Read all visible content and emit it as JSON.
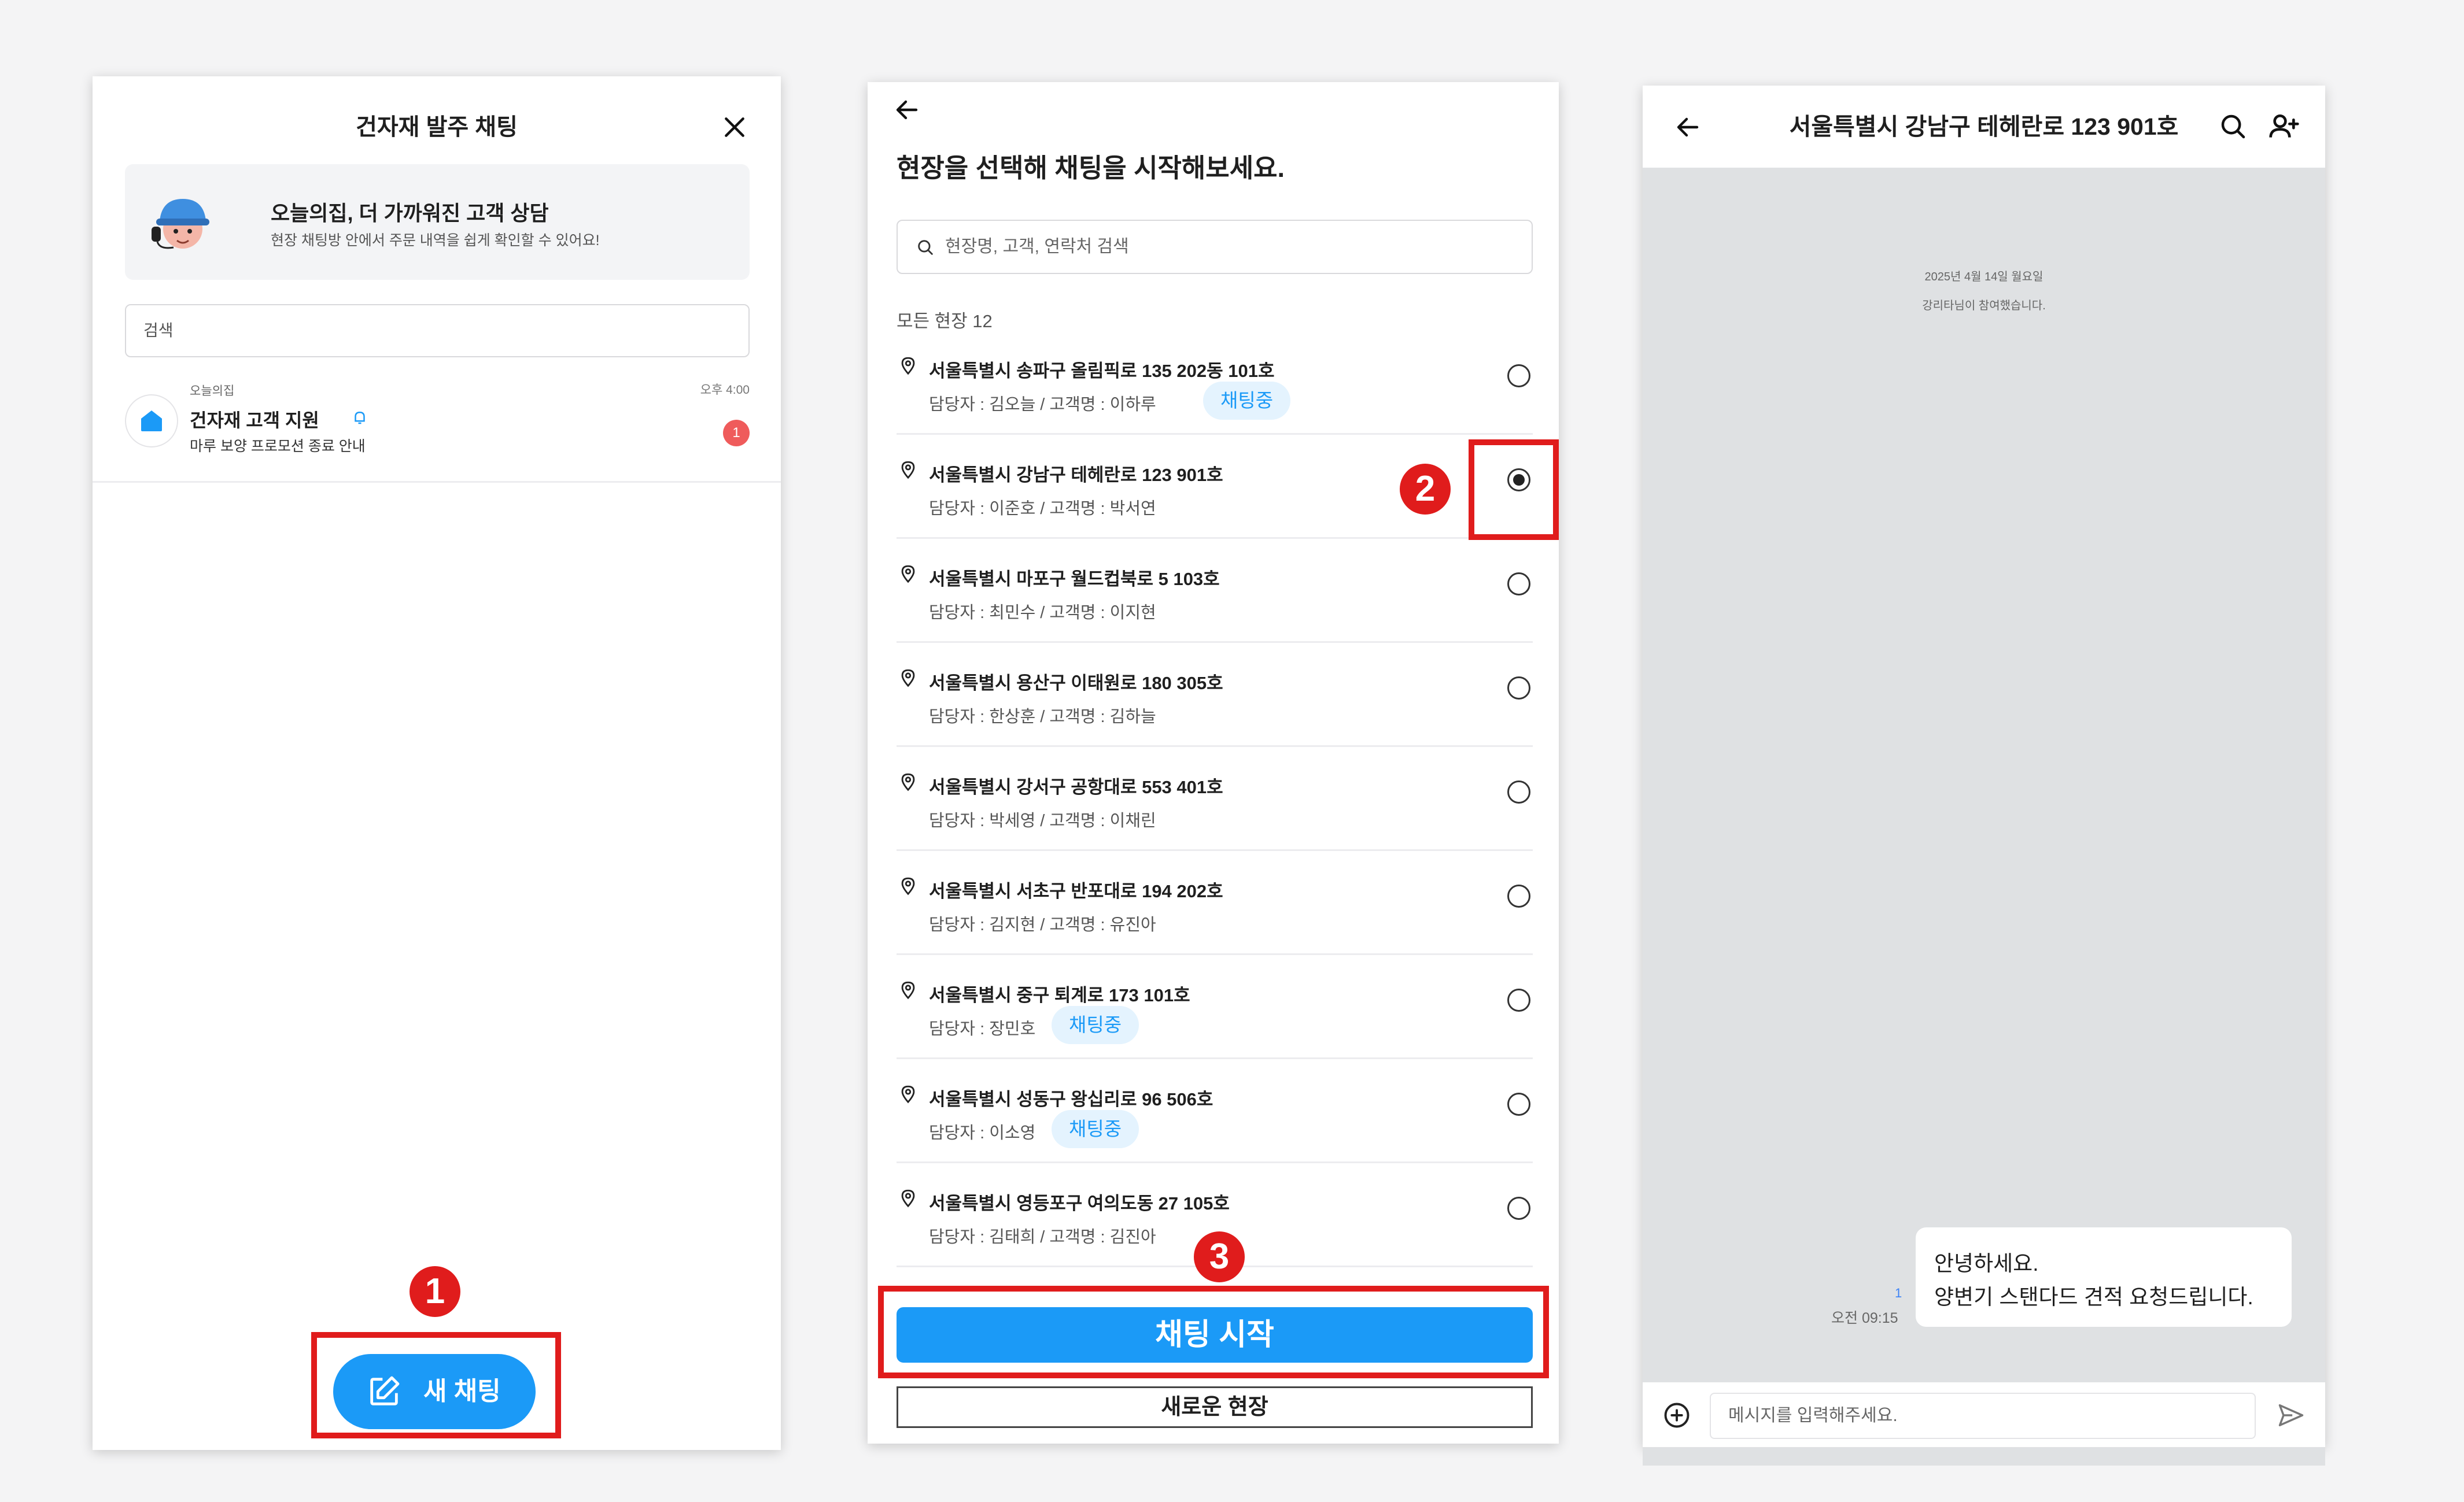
{
  "panel1": {
    "title": "건자재 발주 채팅",
    "banner": {
      "title": "오늘의집, 더 가까워진 고객 상담",
      "subtitle": "현장 채팅방 안에서 주문 내역을 쉽게 확인할 수 있어요!"
    },
    "search_placeholder": "검색",
    "room": {
      "sender": "오늘의집",
      "name": "건자재 고객 지원",
      "preview": "마루 보양 프로모션 종료 안내",
      "time": "오후 4:00",
      "unread": "1"
    },
    "new_chat_label": "새 채팅"
  },
  "panel2": {
    "heading": "현장을 선택해 채팅을 시작해보세요.",
    "search_placeholder": "현장명, 고객, 연락처 검색",
    "count_label": "모든 현장 12",
    "items": [
      {
        "address": "서울특별시 송파구 올림픽로 135 202동 101호",
        "meta": "담당자 : 김오늘 / 고객명 : 이하루",
        "tag": "채팅중",
        "selected": false
      },
      {
        "address": "서울특별시 강남구 테헤란로 123 901호",
        "meta": "담당자 : 이준호 / 고객명 : 박서연",
        "tag": "",
        "selected": true
      },
      {
        "address": "서울특별시 마포구 월드컵북로 5 103호",
        "meta": "담당자 : 최민수 / 고객명 : 이지현",
        "tag": "",
        "selected": false
      },
      {
        "address": "서울특별시 용산구 이태원로 180 305호",
        "meta": "담당자 : 한상훈 / 고객명 : 김하늘",
        "tag": "",
        "selected": false
      },
      {
        "address": "서울특별시 강서구 공항대로 553 401호",
        "meta": "담당자 : 박세영 / 고객명 : 이채린",
        "tag": "",
        "selected": false
      },
      {
        "address": "서울특별시 서초구 반포대로 194 202호",
        "meta": "담당자 : 김지현 / 고객명 : 유진아",
        "tag": "",
        "selected": false
      },
      {
        "address": "서울특별시 중구 퇴계로 173 101호",
        "meta": "담당자 : 장민호",
        "tag": "채팅중",
        "selected": false
      },
      {
        "address": "서울특별시 성동구 왕십리로 96 506호",
        "meta": "담당자 : 이소영",
        "tag": "채팅중",
        "selected": false
      },
      {
        "address": "서울특별시 영등포구 여의도동 27 105호",
        "meta": "담당자 : 김태희  / 고객명 : 김진아",
        "tag": "",
        "selected": false
      }
    ],
    "start_label": "채팅 시작",
    "new_site_label": "새로운 현장"
  },
  "panel3": {
    "title": "서울특별시 강남구 테헤란로 123 901호",
    "date": "2025년 4월 14일 월요일",
    "system_message": "강리타님이 참여했습니다.",
    "message_lines": [
      "안녕하세요.",
      "양변기 스탠다드 견적 요청드립니다."
    ],
    "read_count": "1",
    "message_time": "오전 09:15",
    "input_placeholder": "메시지를 입력해주세요."
  },
  "annotations": {
    "steps": [
      "1",
      "2",
      "3"
    ],
    "highlight_color": "#e01c1c"
  },
  "colors": {
    "accent": "#1b9af7",
    "tag_bg": "#e4f3fe",
    "chat_bg": "#dfe1e3",
    "unread_badge": "#ef5b5b"
  },
  "icons": [
    "close-icon",
    "agent-avatar-icon",
    "house-icon",
    "bell-icon",
    "edit-icon",
    "back-arrow-icon",
    "search-icon",
    "location-pin-icon",
    "invite-user-icon",
    "plus-circle-icon",
    "send-icon"
  ]
}
